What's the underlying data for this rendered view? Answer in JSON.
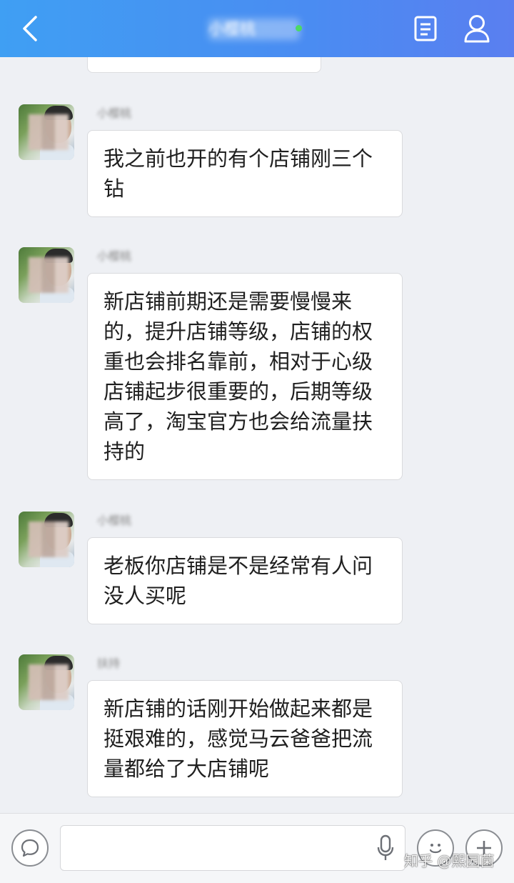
{
  "header": {
    "title": "小樱桃",
    "back_icon": "chevron-left-icon",
    "doc_icon": "document-icon",
    "profile_icon": "person-icon",
    "online_color": "#4cd964"
  },
  "messages": [
    {
      "sender": "小樱桃",
      "text": "我之前也开的有个店铺刚三个钻"
    },
    {
      "sender": "小樱桃",
      "text": "新店铺前期还是需要慢慢来的，提升店铺等级，店铺的权重也会排名靠前，相对于心级店铺起步很重要的，后期等级高了，淘宝官方也会给流量扶持的"
    },
    {
      "sender": "小樱桃",
      "text": "老板你店铺是不是经常有人问没人买呢"
    },
    {
      "sender": "扶持",
      "text": "新店铺的话刚开始做起来都是挺艰难的，感觉马云爸爸把流量都给了大店铺呢"
    }
  ],
  "input_bar": {
    "placeholder": "",
    "voice_icon": "speech-bubble-icon",
    "mic_icon": "microphone-icon",
    "emoji_icon": "emoji-icon",
    "plus_icon": "plus-icon"
  },
  "watermark": "知乎 @熙园菌"
}
